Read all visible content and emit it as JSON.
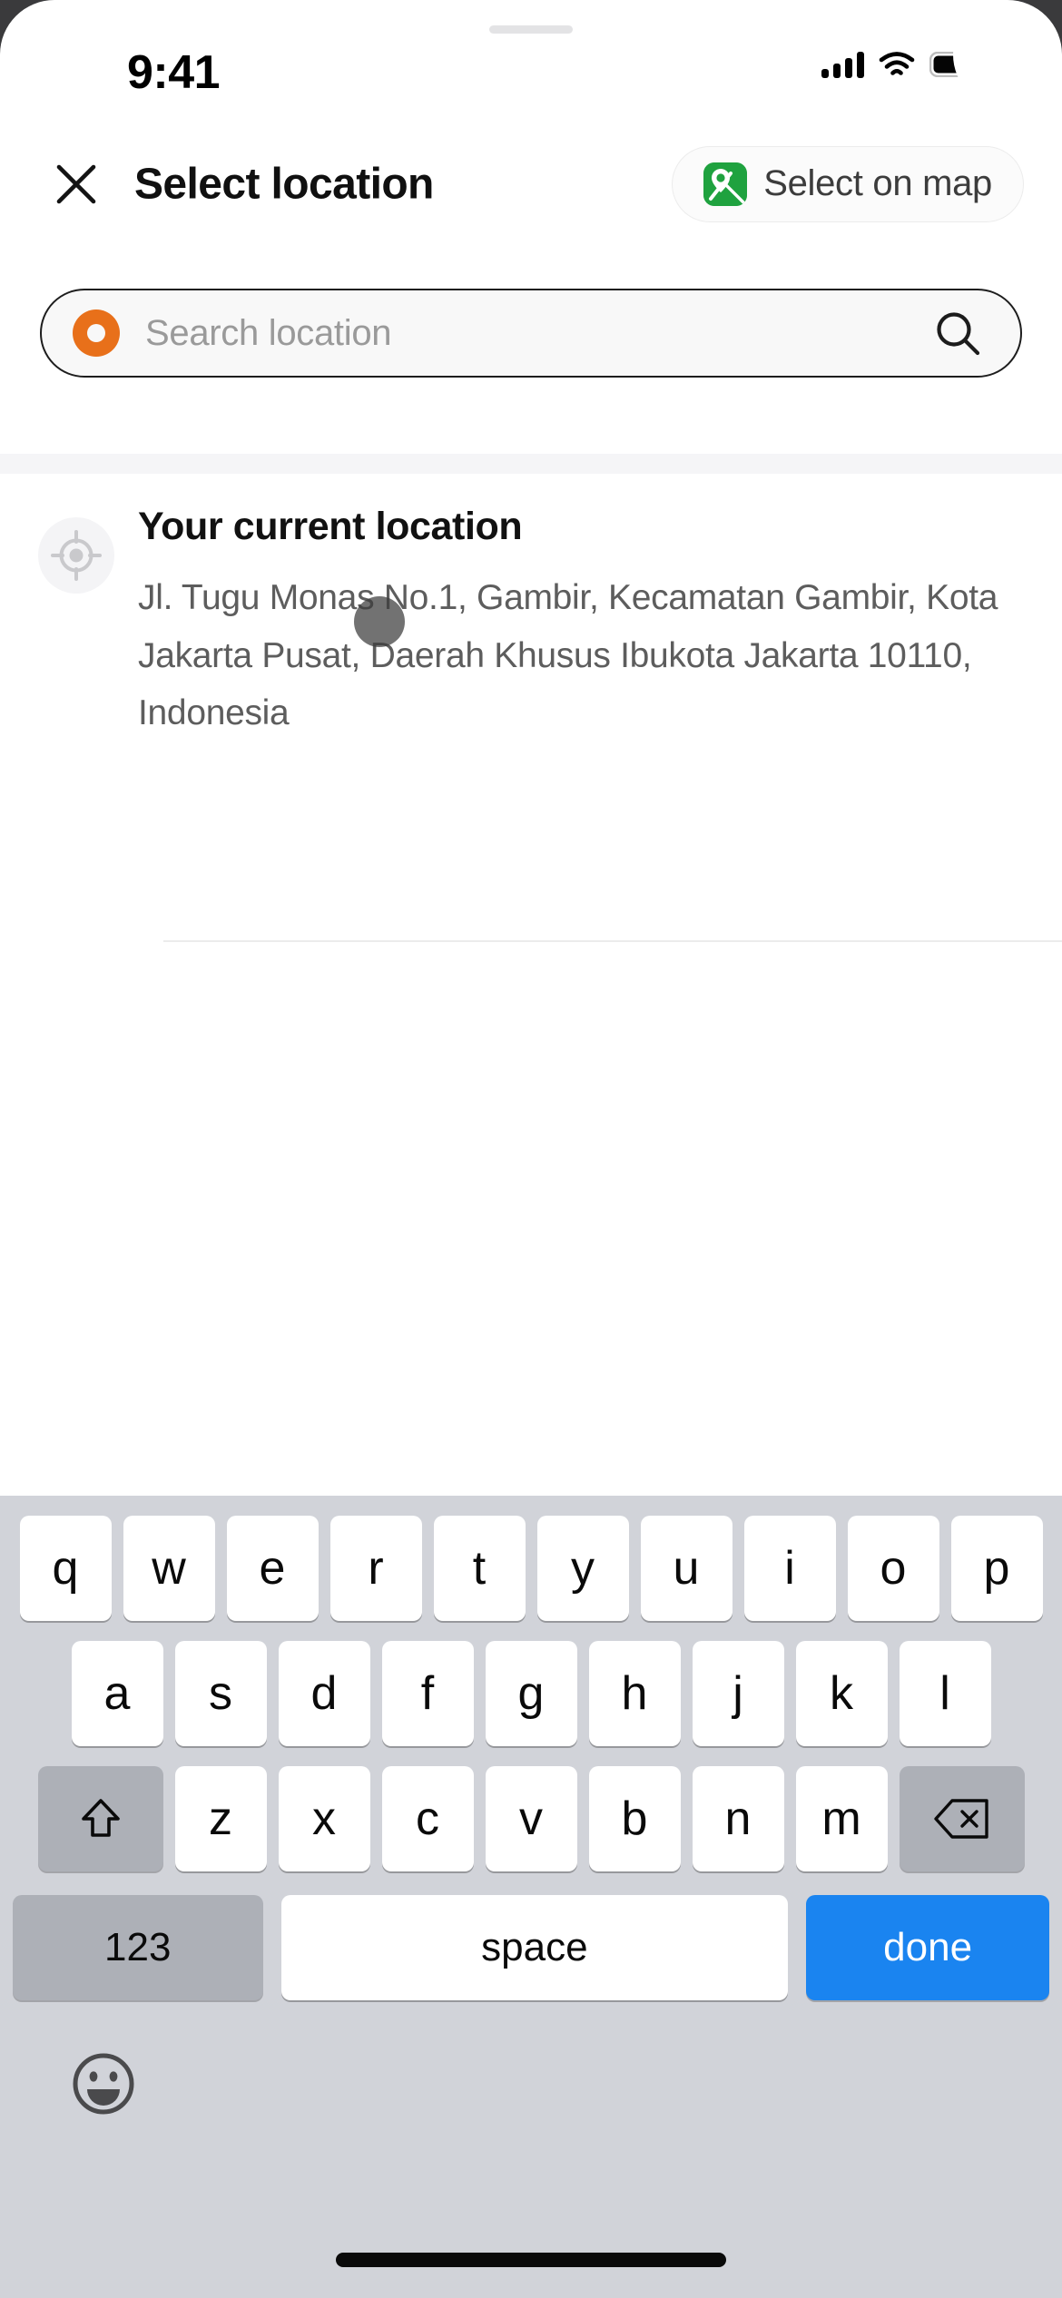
{
  "status_bar": {
    "time": "9:41",
    "icons": [
      "cellular-signal-icon",
      "wifi-icon",
      "battery-icon"
    ],
    "battery_level_percent": 100
  },
  "header": {
    "close_icon": "close-icon",
    "title": "Select location",
    "map_button": {
      "label": "Select on map",
      "icon": "google-maps-pin-icon",
      "icon_color": "#1fa23f"
    }
  },
  "search": {
    "leading_icon": "orange-dot-icon",
    "leading_icon_color": "#e8701a",
    "placeholder": "Search location",
    "value": "",
    "trailing_icon": "search-icon"
  },
  "results": [
    {
      "icon": "crosshair-location-icon",
      "title": "Your current location",
      "address": "Jl. Tugu Monas No.1, Gambir, Kecamatan Gambir, Kota Jakarta Pusat, Daerah Khusus Ibukota Jakarta 10110, Indonesia"
    }
  ],
  "keyboard": {
    "row1": [
      "q",
      "w",
      "e",
      "r",
      "t",
      "y",
      "u",
      "i",
      "o",
      "p"
    ],
    "row2": [
      "a",
      "s",
      "d",
      "f",
      "g",
      "h",
      "j",
      "k",
      "l"
    ],
    "row3": [
      "z",
      "x",
      "c",
      "v",
      "b",
      "n",
      "m"
    ],
    "shift_icon": "shift-arrow-icon",
    "backspace_icon": "backspace-delete-icon",
    "numbers_key": "123",
    "space_key": "space",
    "return_key": "done",
    "emoji_icon": "emoji-smiley-icon",
    "return_key_color": "#1a84f0"
  },
  "system": {
    "home_indicator": "home-indicator",
    "sheet_handle": "sheet-drag-handle"
  }
}
